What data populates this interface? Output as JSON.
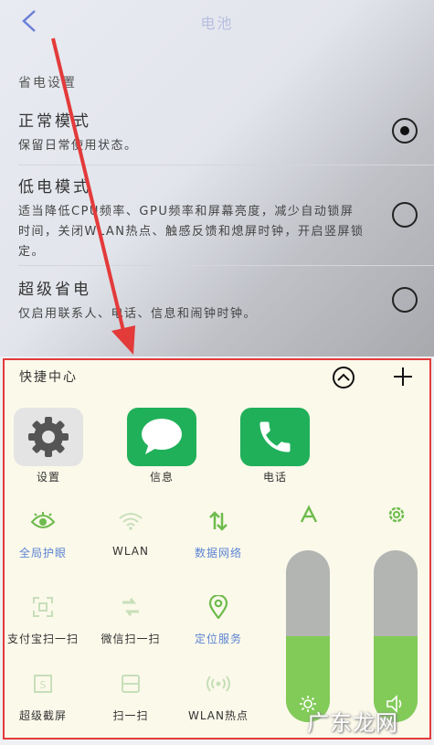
{
  "header": {
    "title": "电池"
  },
  "power_settings": {
    "section_label": "省电设置",
    "options": [
      {
        "name": "正常模式",
        "desc": "保留日常使用状态。",
        "selected": true
      },
      {
        "name": "低电模式",
        "desc": "适当降低CPU频率、GPU频率和屏幕亮度，减少自动锁屏时间，关闭WLAN热点、触感反馈和熄屏时钟，开启竖屏锁定。",
        "selected": false
      },
      {
        "name": "超级省电",
        "desc": "仅启用联系人、电话、信息和闹钟时钟。",
        "selected": false
      }
    ]
  },
  "quick_panel": {
    "title": "快捷中心",
    "apps": [
      {
        "label": "设置",
        "icon": "gear-icon"
      },
      {
        "label": "信息",
        "icon": "message-icon"
      },
      {
        "label": "电话",
        "icon": "phone-icon"
      }
    ],
    "toggles": [
      {
        "label": "全局护眼",
        "icon": "eye-icon",
        "active": true
      },
      {
        "label": "WLAN",
        "icon": "wifi-icon",
        "active": false
      },
      {
        "label": "数据网络",
        "icon": "data-arrows-icon",
        "active": true
      },
      {
        "label": "支付宝扫一扫",
        "icon": "scan-frame-icon",
        "active": false
      },
      {
        "label": "微信扫一扫",
        "icon": "wechat-scan-icon",
        "active": false
      },
      {
        "label": "定位服务",
        "icon": "location-icon",
        "active": true
      },
      {
        "label": "超级截屏",
        "icon": "screenshot-icon",
        "active": false
      },
      {
        "label": "扫一扫",
        "icon": "scan-icon",
        "active": false
      },
      {
        "label": "WLAN热点",
        "icon": "hotspot-icon",
        "active": false
      }
    ],
    "sliders": [
      {
        "top_icon": "font-size-icon",
        "bottom_icon": "brightness-icon",
        "level": 0.5
      },
      {
        "top_icon": "settings-icon",
        "bottom_icon": "volume-icon",
        "level": 0.5
      }
    ]
  },
  "colors": {
    "accent_green": "#82cb58",
    "inactive_gray": "#b3b5b3",
    "annotation_red": "#e33a3a"
  },
  "watermark": "广东龙网"
}
